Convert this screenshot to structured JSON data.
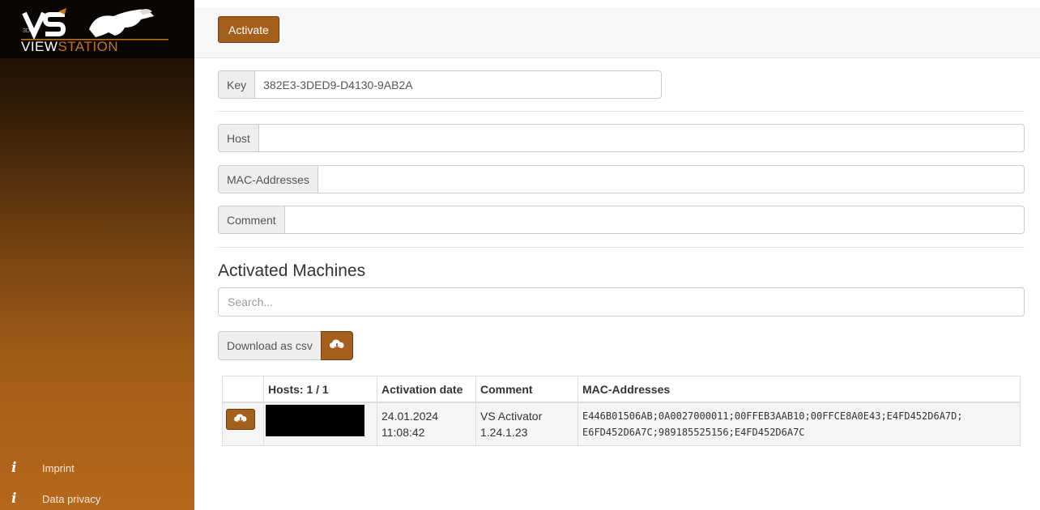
{
  "sidebar": {
    "logo_text": "VIEWSTATION",
    "logo_badge": "VS",
    "logo_small": "3D",
    "links": [
      {
        "label": "Imprint",
        "icon": "info-icon"
      },
      {
        "label": "Data privacy",
        "icon": "info-icon"
      }
    ]
  },
  "toolbar": {
    "activate_label": "Activate"
  },
  "form": {
    "key_label": "Key",
    "key_value": "382E3-3DED9-D4130-9AB2A",
    "host_label": "Host",
    "host_value": "",
    "mac_label": "MAC-Addresses",
    "mac_value": "",
    "comment_label": "Comment",
    "comment_value": ""
  },
  "machines": {
    "title": "Activated Machines",
    "search_placeholder": "Search...",
    "download_label": "Download as csv",
    "columns": [
      "",
      "Hosts: 1 / 1",
      "Activation date",
      "Comment",
      "MAC-Addresses"
    ],
    "rows": [
      {
        "host": "",
        "date_line1": "24.01.2024",
        "date_line2": "11:08:42",
        "comment_line1": "VS Activator",
        "comment_line2": "1.24.1.23",
        "mac_line1": "E446B01506AB;0A0027000011;00FFEB3AAB10;00FFCE8A0E43;E4FD452D6A7D;",
        "mac_line2": "E6FD452D6A7C;989185525156;E4FD452D6A7C"
      }
    ]
  },
  "colors": {
    "accent": "#a55f1c",
    "sidebar_dark": "#130c06",
    "sidebar_light": "#b5681c"
  }
}
